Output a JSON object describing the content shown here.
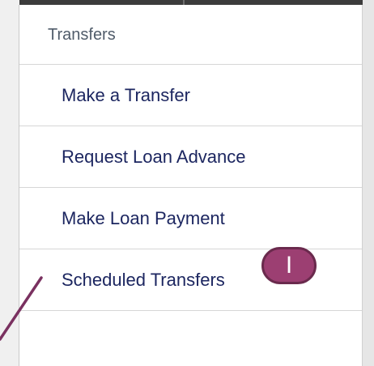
{
  "menu": {
    "header": "Transfers",
    "items": [
      {
        "label": "Make a Transfer"
      },
      {
        "label": "Request Loan Advance"
      },
      {
        "label": "Make Loan Payment"
      },
      {
        "label": "Scheduled Transfers"
      }
    ]
  },
  "callout": {
    "marker": "I",
    "color": "#9c3f72",
    "line_color": "#7a3160"
  }
}
